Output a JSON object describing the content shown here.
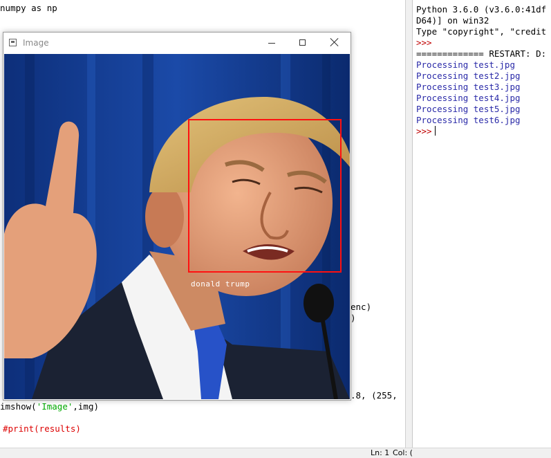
{
  "editor": {
    "line_top": "numpy as np",
    "line_show_func": "imshow(",
    "line_show_arg1": "'Image'",
    "line_show_end": ",img)",
    "line_print": "#print(results)",
    "frag_enc": "enc)",
    "frag_paren": ")",
    "frag_color": ".8, (255,"
  },
  "image_window": {
    "title": "Image",
    "face_label": "donald trump"
  },
  "shell": {
    "lines": [
      "Python 3.6.0 (v3.6.0:41df",
      "D64)] on win32",
      "Type \"copyright\", \"credit"
    ],
    "prompt": ">>>",
    "restart": "============= RESTART: D:",
    "outputs": [
      "Processing test.jpg",
      "Processing test2.jpg",
      "Processing test3.jpg",
      "Processing test4.jpg",
      "Processing test5.jpg",
      "Processing test6.jpg"
    ]
  },
  "status": {
    "ln": "Ln: 1",
    "col": "Col: ("
  },
  "colors": {
    "keyword": "#ff7700",
    "string": "#00aa00",
    "comment": "#dd0000",
    "prompt": "#c00000",
    "output": "#2a2aa8",
    "face_box": "#ff1010"
  }
}
